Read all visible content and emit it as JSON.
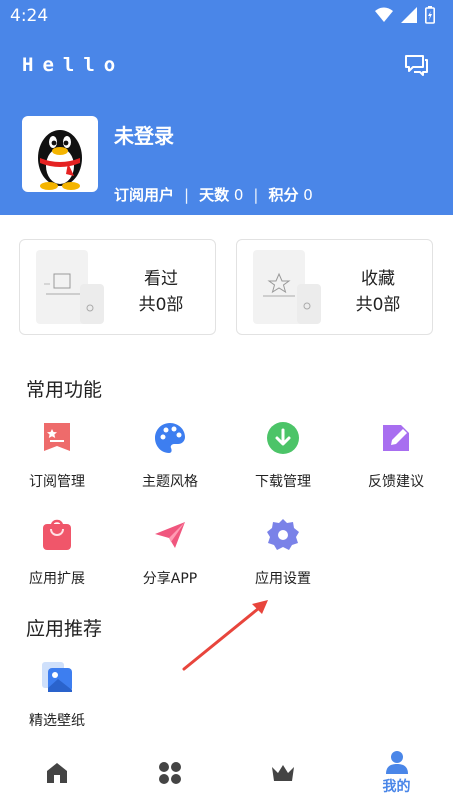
{
  "status": {
    "time": "4:24"
  },
  "header": {
    "title": "Hello",
    "bg_color": "#4a86e8"
  },
  "user": {
    "name": "未登录",
    "type": "订阅用户",
    "days_label": "天数",
    "days_value": "0",
    "points_label": "积分",
    "points_value": "0"
  },
  "cards": [
    {
      "title": "看过",
      "count": "共0部"
    },
    {
      "title": "收藏",
      "count": "共0部"
    }
  ],
  "sections": {
    "common": "常用功能",
    "recommend": "应用推荐"
  },
  "features": [
    {
      "label": "订阅管理",
      "icon": "subscription-icon",
      "color": "#ee6b6b"
    },
    {
      "label": "主题风格",
      "icon": "palette-icon",
      "color": "#3d7ef0"
    },
    {
      "label": "下载管理",
      "icon": "download-icon",
      "color": "#4cc468"
    },
    {
      "label": "反馈建议",
      "icon": "feedback-icon",
      "color": "#a86ef0"
    },
    {
      "label": "应用扩展",
      "icon": "bag-icon",
      "color": "#f0566a"
    },
    {
      "label": "分享APP",
      "icon": "share-icon",
      "color": "#f0567e"
    },
    {
      "label": "应用设置",
      "icon": "settings-icon",
      "color": "#7a82e8"
    }
  ],
  "recommend": [
    {
      "label": "精选壁纸",
      "icon": "wallpaper-icon"
    }
  ],
  "tabs": [
    {
      "icon": "home-icon"
    },
    {
      "icon": "apps-icon"
    },
    {
      "icon": "crown-icon"
    },
    {
      "icon": "profile-icon",
      "label": "我的",
      "active": true
    }
  ],
  "accent_color": "#4a86e8",
  "annotation_arrow_color": "#e8453c"
}
